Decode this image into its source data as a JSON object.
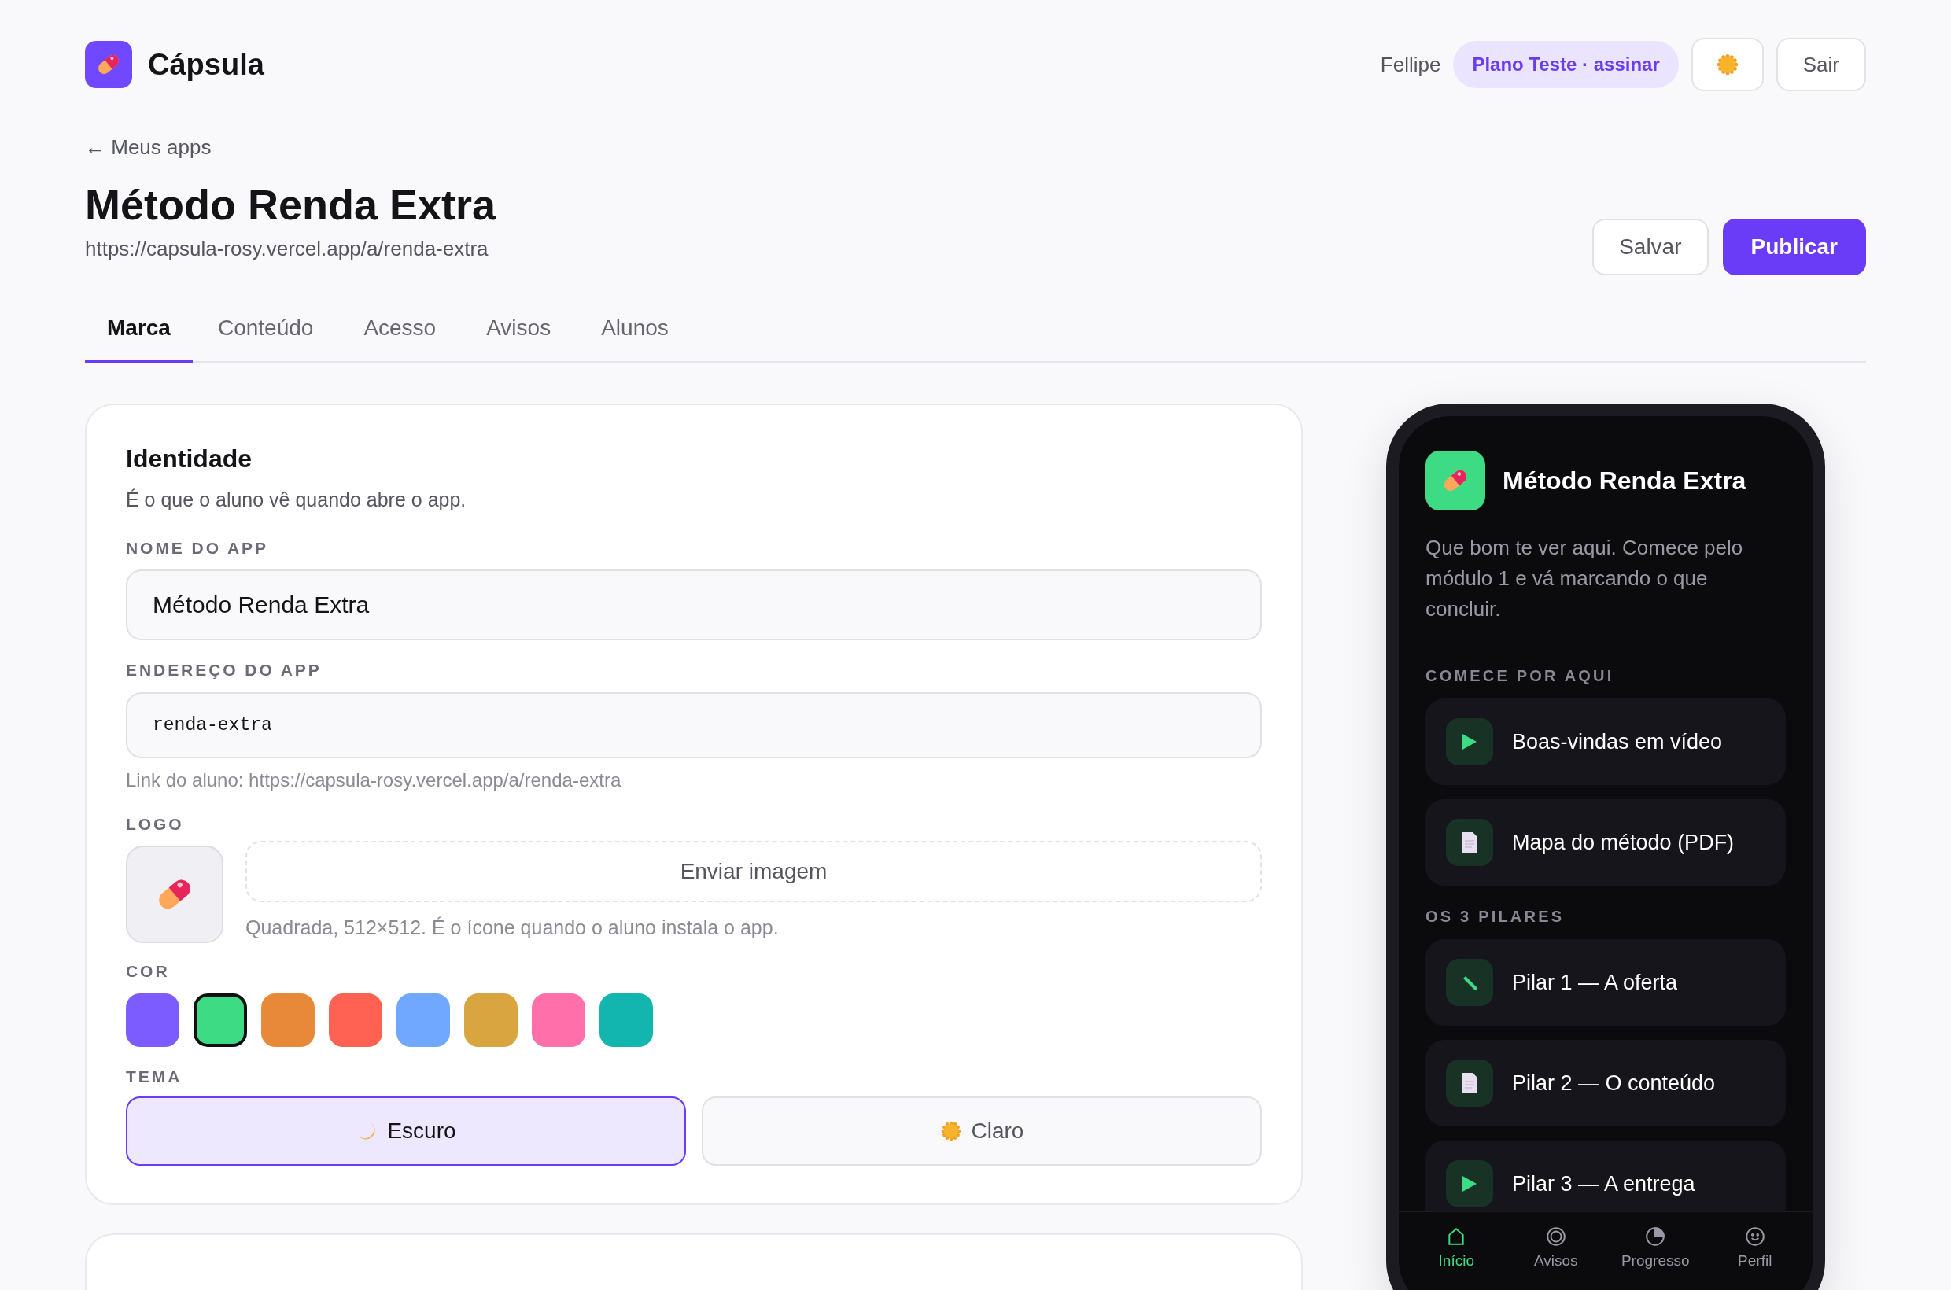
{
  "header": {
    "brand": "Cápsula",
    "user": "Fellipe",
    "plan_badge": "Plano Teste · assinar",
    "logout": "Sair"
  },
  "back_link": "← Meus apps",
  "title": "Método Renda Extra",
  "url": "https://capsula-rosy.vercel.app/a/renda-extra",
  "actions": [
    {
      "label": "Salvar",
      "kind": "secondary"
    },
    {
      "label": "Publicar",
      "kind": "primary"
    }
  ],
  "tabs": [
    {
      "label": "Marca",
      "selected": true
    },
    {
      "label": "Conteúdo",
      "selected": false
    },
    {
      "label": "Acesso",
      "selected": false
    },
    {
      "label": "Avisos",
      "selected": false
    },
    {
      "label": "Alunos",
      "selected": false
    }
  ],
  "identity": {
    "title": "Identidade",
    "subtitle": "É o que o aluno vê quando abre o app.",
    "name_label": "NOME DO APP",
    "name_value": "Método Renda Extra",
    "address_label": "ENDEREÇO DO APP",
    "address_value": "renda-extra",
    "address_hint": "Link do aluno: https://capsula-rosy.vercel.app/a/renda-extra",
    "logo_label": "LOGO",
    "upload_button": "Enviar imagem",
    "logo_hint": "Quadrada, 512×512. É o ícone quando o aluno instala o app.",
    "color_label": "COR",
    "colors": [
      {
        "color": "#7c5cff",
        "selected": false
      },
      {
        "color": "#3ddc84",
        "selected": true
      },
      {
        "color": "#e8893a",
        "selected": false
      },
      {
        "color": "#ff6152",
        "selected": false
      },
      {
        "color": "#70a8ff",
        "selected": false
      },
      {
        "color": "#d8a540",
        "selected": false
      },
      {
        "color": "#ff6faa",
        "selected": false
      },
      {
        "color": "#13b5af",
        "selected": false
      }
    ],
    "theme_label": "TEMA",
    "themes": [
      {
        "label": "Escuro",
        "kind": "moon",
        "selected": true
      },
      {
        "label": "Claro",
        "kind": "sun",
        "selected": false
      }
    ]
  },
  "phone": {
    "title": "Método Renda Extra",
    "description": "Que bom te ver aqui. Comece pelo módulo 1 e vá marcando o que concluir.",
    "sections": [
      {
        "title": "COMECE POR AQUI",
        "items": [
          {
            "label": "Boas-vindas em vídeo",
            "kind": "video"
          },
          {
            "label": "Mapa do método (PDF)",
            "kind": "document"
          }
        ]
      },
      {
        "title": "OS 3 PILARES",
        "items": [
          {
            "label": "Pilar 1 — A oferta",
            "kind": "task"
          },
          {
            "label": "Pilar 2 — O conteúdo",
            "kind": "document"
          },
          {
            "label": "Pilar 3 — A entrega",
            "kind": "video"
          }
        ]
      }
    ],
    "nav": [
      {
        "label": "Início",
        "kind": "home",
        "selected": true
      },
      {
        "label": "Avisos",
        "kind": "notices",
        "selected": false
      },
      {
        "label": "Progresso",
        "kind": "progress",
        "selected": false
      },
      {
        "label": "Perfil",
        "kind": "profile",
        "selected": false
      }
    ]
  }
}
